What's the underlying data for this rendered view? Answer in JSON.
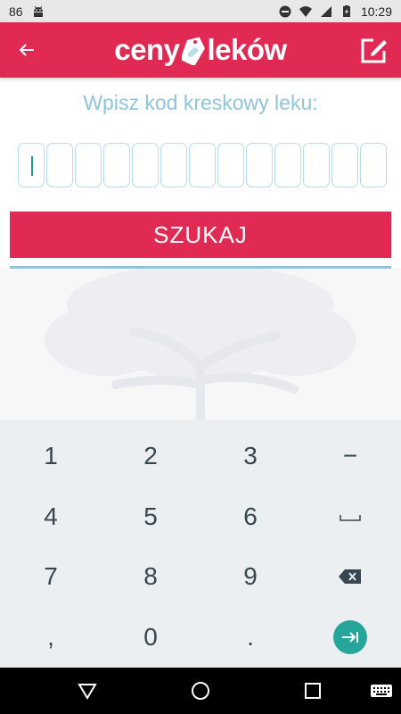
{
  "status_bar": {
    "left_number": "86",
    "time": "10:29"
  },
  "app_bar": {
    "logo_part1": "ceny",
    "logo_part2": "leków"
  },
  "prompt": "Wpisz kod kreskowy leku:",
  "barcode": {
    "box_count": 13,
    "active_index": 0
  },
  "search_button_label": "SZUKAJ",
  "keyboard": {
    "rows": [
      [
        "1",
        "2",
        "3",
        "−"
      ],
      [
        "4",
        "5",
        "6",
        "␣"
      ],
      [
        "7",
        "8",
        "9",
        "⌫"
      ],
      [
        ",",
        "0",
        ".",
        "⇥"
      ]
    ]
  },
  "icons": {
    "back": "arrow-left-icon",
    "edit": "edit-note-icon",
    "backspace": "backspace-icon",
    "enter": "enter-next-icon"
  },
  "colors": {
    "brand": "#e02a53",
    "accent": "#8fc4dc",
    "enter": "#26a69a",
    "keyboard_bg": "#eceff1"
  }
}
